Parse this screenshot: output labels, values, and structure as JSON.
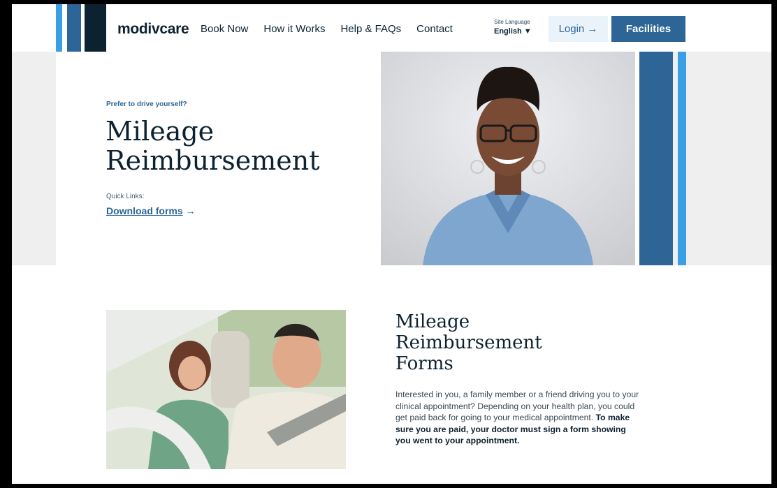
{
  "header": {
    "brand": "modivcare",
    "nav": [
      "Book Now",
      "How it Works",
      "Help & FAQs",
      "Contact"
    ],
    "language_label": "Site Language",
    "language_value": "English ▼",
    "login_label": "Login →",
    "facilities_label": "Facilities"
  },
  "hero": {
    "eyebrow": "Prefer to drive yourself?",
    "title_line1": "Mileage",
    "title_line2": "Reimbursement",
    "quick_links_label": "Quick Links:",
    "download_label": "Download forms",
    "download_arrow": " →"
  },
  "forms_section": {
    "title_line1": "Mileage",
    "title_line2": "Reimbursement",
    "title_line3": "Forms",
    "body_plain": "Interested in you, a family member or a friend driving you to your clinical appointment? Depending on your health plan, you could get paid back for going to your medical appointment. ",
    "body_bold": "To make sure you are paid, your doctor must sign a form showing you went to your appointment."
  },
  "colors": {
    "navy": "#0d2230",
    "blue": "#2c6596",
    "sky": "#3aa0e6",
    "hero_bg": "#efefef"
  }
}
